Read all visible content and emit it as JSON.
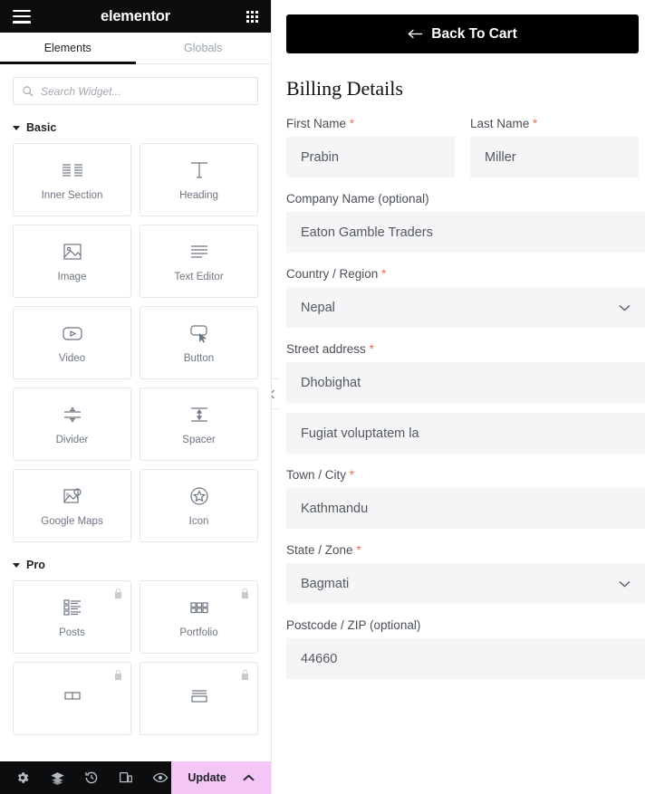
{
  "panel": {
    "brand": "elementor",
    "menu_icon": "hamburger-icon",
    "apps_icon": "grid-apps-icon",
    "tabs": [
      {
        "label": "Elements",
        "active": true
      },
      {
        "label": "Globals",
        "active": false
      }
    ],
    "search": {
      "placeholder": "Search Widget...",
      "value": ""
    },
    "categories": [
      {
        "title": "Basic",
        "widgets": [
          {
            "label": "Inner Section",
            "icon": "inner-section-icon",
            "pro": false
          },
          {
            "label": "Heading",
            "icon": "heading-icon",
            "pro": false
          },
          {
            "label": "Image",
            "icon": "image-icon",
            "pro": false
          },
          {
            "label": "Text Editor",
            "icon": "text-editor-icon",
            "pro": false
          },
          {
            "label": "Video",
            "icon": "video-icon",
            "pro": false
          },
          {
            "label": "Button",
            "icon": "button-icon",
            "pro": false
          },
          {
            "label": "Divider",
            "icon": "divider-icon",
            "pro": false
          },
          {
            "label": "Spacer",
            "icon": "spacer-icon",
            "pro": false
          },
          {
            "label": "Google Maps",
            "icon": "google-maps-icon",
            "pro": false
          },
          {
            "label": "Icon",
            "icon": "star-icon",
            "pro": false
          }
        ]
      },
      {
        "title": "Pro",
        "widgets": [
          {
            "label": "Posts",
            "icon": "posts-icon",
            "pro": true
          },
          {
            "label": "Portfolio",
            "icon": "portfolio-icon",
            "pro": true
          },
          {
            "label": "",
            "icon": "slides-icon",
            "pro": true
          },
          {
            "label": "",
            "icon": "form-icon",
            "pro": true
          }
        ]
      }
    ],
    "footer": {
      "buttons": [
        {
          "name": "settings-icon"
        },
        {
          "name": "navigator-icon"
        },
        {
          "name": "history-icon"
        },
        {
          "name": "responsive-mode-icon"
        },
        {
          "name": "preview-icon"
        }
      ],
      "update_label": "Update",
      "update_color": "#f4c6f6",
      "arrow_icon": "chevron-up-icon"
    }
  },
  "preview": {
    "back_to_cart": {
      "label": "Back To Cart",
      "icon": "arrow-left-icon"
    },
    "title": "Billing Details",
    "required_mark": "*",
    "collapse_handle_icon": "chevron-left-icon",
    "fields": [
      {
        "label": "First Name",
        "required": true,
        "value": "Prabin",
        "type": "text"
      },
      {
        "label": "Last Name",
        "required": true,
        "value": "Miller",
        "type": "text"
      },
      {
        "label": "Company Name (optional)",
        "required": false,
        "value": "Eaton Gamble Traders",
        "type": "text"
      },
      {
        "label": "Country / Region",
        "required": true,
        "value": "Nepal",
        "type": "select"
      },
      {
        "label": "Street address",
        "required": true,
        "value": "Dhobighat",
        "type": "text"
      },
      {
        "label": "",
        "required": false,
        "value": "Fugiat voluptatem la",
        "type": "text"
      },
      {
        "label": "Town / City",
        "required": true,
        "value": "Kathmandu",
        "type": "text"
      },
      {
        "label": "State / Zone",
        "required": true,
        "value": "Bagmati",
        "type": "select"
      },
      {
        "label": "Postcode / ZIP (optional)",
        "required": false,
        "value": "44660",
        "type": "text"
      }
    ]
  }
}
